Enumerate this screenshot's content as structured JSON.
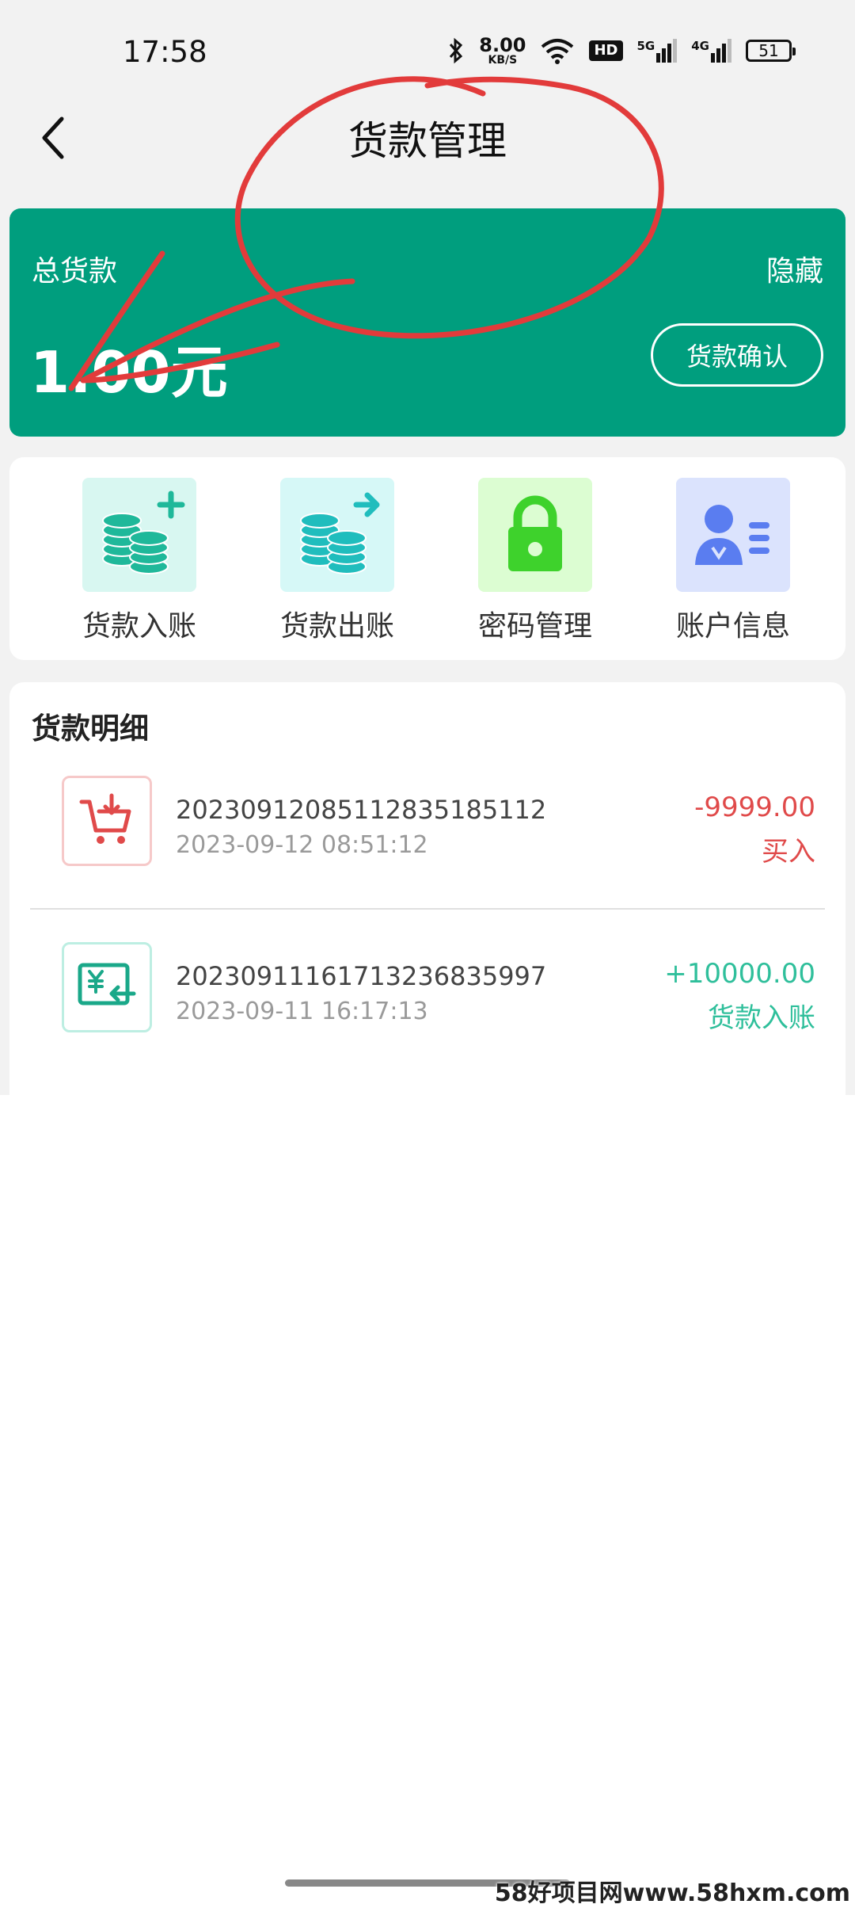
{
  "status_bar": {
    "time": "17:58",
    "net_speed": "8.00",
    "net_speed_unit": "KB/S",
    "hd_label": "HD",
    "sim1_label": "5G",
    "sim2_label": "4G",
    "battery_level": "51"
  },
  "nav": {
    "title": "货款管理",
    "back_icon": "chevron-left-icon"
  },
  "balance": {
    "label": "总货款",
    "hide_label": "隐藏",
    "amount": "1.00元",
    "confirm_label": "货款确认",
    "card_color": "#009e7e"
  },
  "actions": [
    {
      "label": "货款入账",
      "icon": "coins-plus-icon"
    },
    {
      "label": "货款出账",
      "icon": "coins-arrow-icon"
    },
    {
      "label": "密码管理",
      "icon": "lock-icon"
    },
    {
      "label": "账户信息",
      "icon": "account-card-icon"
    }
  ],
  "details": {
    "title": "货款明细",
    "records": [
      {
        "id": "20230912085112835185112",
        "date": "2023-09-12 08:51:12",
        "amount": "-9999.00",
        "type": "买入",
        "icon": "cart-download-icon",
        "color": "#e04a4a"
      },
      {
        "id": "20230911161713236835997",
        "date": "2023-09-11 16:17:13",
        "amount": "+10000.00",
        "type": "货款入账",
        "icon": "yuan-transfer-icon",
        "color": "#2fbf9b"
      }
    ]
  },
  "watermark": "58好项目网www.58hxm.com",
  "colors": {
    "accent_green": "#009e7e",
    "negative_red": "#e04a4a",
    "positive_teal": "#2fbf9b",
    "annotation_red": "#e23b3b"
  }
}
